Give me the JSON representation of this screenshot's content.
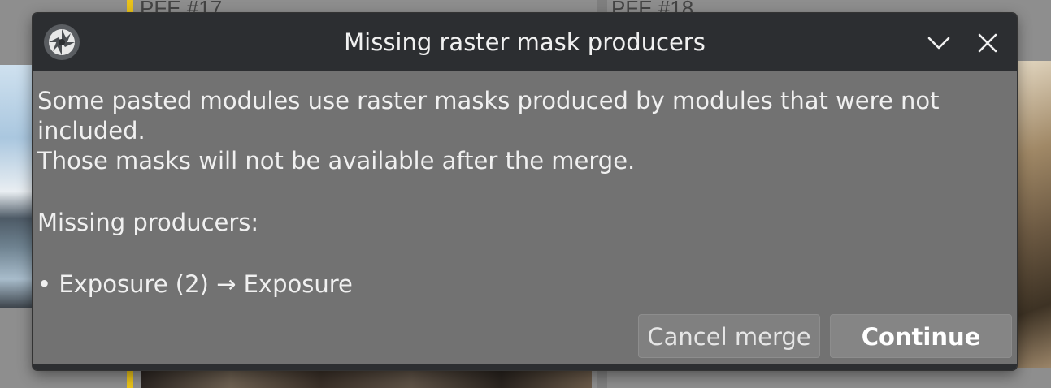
{
  "background": {
    "left_label": "PFE #17",
    "right_label": "PFE #18"
  },
  "dialog": {
    "title": "Missing raster mask producers",
    "message_line1": "Some pasted modules use raster masks produced by modules that were not included.",
    "message_line2": "Those masks will not be available after the merge.",
    "producers_heading": "Missing producers:",
    "producers": [
      "• Exposure (2) → Exposure"
    ],
    "buttons": {
      "cancel": "Cancel merge",
      "continue": "Continue"
    },
    "icons": {
      "app": "darktable-aperture-icon",
      "collapse": "chevron-down-icon",
      "close": "close-icon"
    }
  }
}
